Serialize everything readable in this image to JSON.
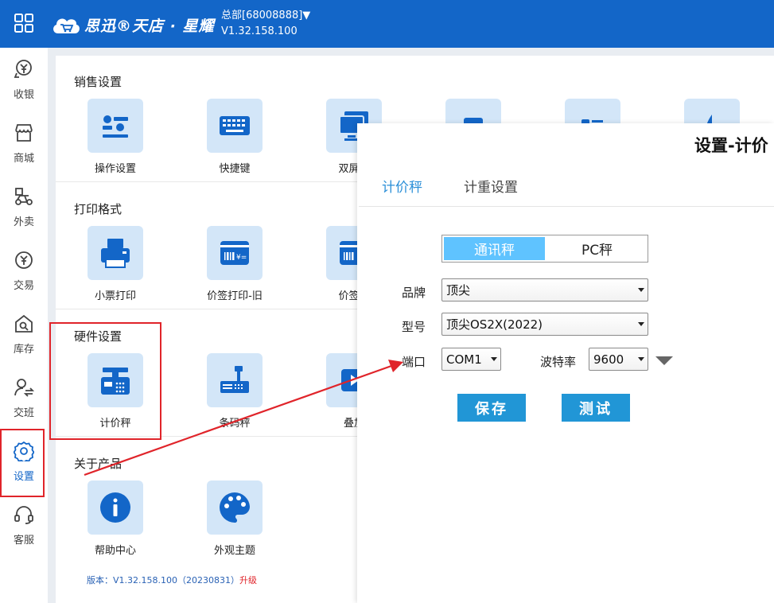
{
  "header": {
    "logo_text": "思迅®天店 · 星耀",
    "store": "总部[68008888]▼",
    "version": "V1.32.158.100"
  },
  "sidebar": {
    "items": [
      {
        "label": "收银",
        "icon": "cashier-icon"
      },
      {
        "label": "商城",
        "icon": "shop-icon"
      },
      {
        "label": "外卖",
        "icon": "delivery-icon"
      },
      {
        "label": "交易",
        "icon": "transaction-icon"
      },
      {
        "label": "库存",
        "icon": "inventory-icon"
      },
      {
        "label": "交班",
        "icon": "shift-icon"
      },
      {
        "label": "设置",
        "icon": "gear-icon",
        "active": true
      },
      {
        "label": "客服",
        "icon": "headset-icon"
      }
    ]
  },
  "sections": {
    "sales": {
      "title": "销售设置",
      "tiles": [
        "操作设置",
        "快捷键",
        "双屏设"
      ]
    },
    "print": {
      "title": "打印格式",
      "tiles": [
        "小票打印",
        "价签打印-旧",
        "价签打"
      ]
    },
    "hardware": {
      "title": "硬件设置",
      "tiles": [
        "计价秤",
        "条码秤",
        "叠加"
      ]
    },
    "about": {
      "title": "关于产品",
      "tiles": [
        "帮助中心",
        "外观主题"
      ]
    }
  },
  "footer": {
    "version_text": "版本：V1.32.158.100（20230831）",
    "upgrade": "升级"
  },
  "dialog": {
    "title": "设置-计价",
    "tabs": [
      "计价秤",
      "计重设置"
    ],
    "segment": {
      "on": "通讯秤",
      "off": "PC秤"
    },
    "brand_label": "品牌",
    "brand_value": "顶尖",
    "model_label": "型号",
    "model_value": "顶尖OS2X(2022)",
    "port_label": "端口",
    "port_value": "COM1",
    "baud_label": "波特率",
    "baud_value": "9600",
    "save": "保存",
    "test": "测试"
  },
  "colors": {
    "header_bg": "#1366c8",
    "accent": "#2196d6",
    "highlight": "#e0242a"
  }
}
